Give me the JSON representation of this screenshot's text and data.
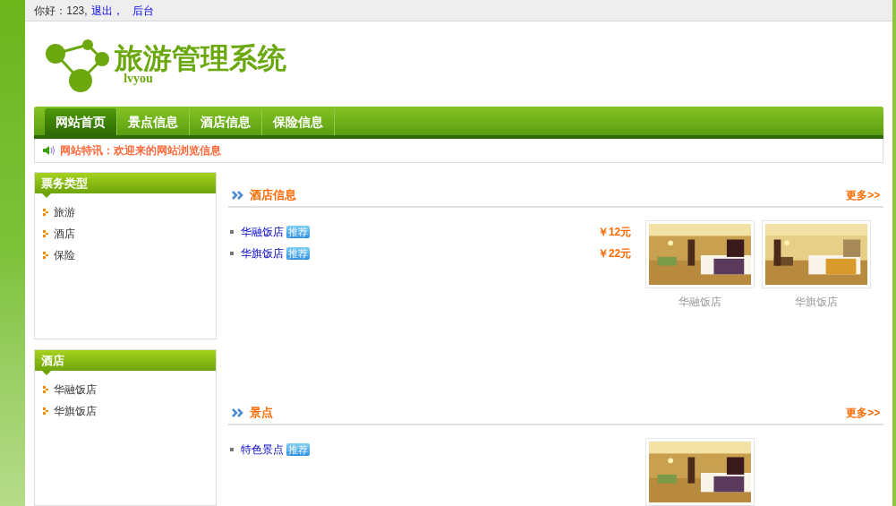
{
  "top_bar": {
    "greeting": "你好：123,",
    "links": [
      "退出，",
      "后台"
    ]
  },
  "logo": {
    "title": "旅游管理系统",
    "subtitle": "lvyou"
  },
  "nav": [
    {
      "label": "网站首页",
      "selected": true
    },
    {
      "label": "景点信息",
      "selected": false
    },
    {
      "label": "酒店信息",
      "selected": false
    },
    {
      "label": "保险信息",
      "selected": false
    }
  ],
  "notice": "网站特讯：欢迎来的网站浏览信息",
  "sidebar": [
    {
      "title": "票务类型",
      "items": [
        "旅游",
        "酒店",
        "保险"
      ]
    },
    {
      "title": "酒店",
      "items": [
        "华融饭店",
        "华旗饭店"
      ]
    }
  ],
  "sections": [
    {
      "title": "酒店信息",
      "more": "更多>>",
      "items": [
        {
          "name": "华融饭店",
          "badge": "推荐",
          "price": "￥12元"
        },
        {
          "name": "华旗饭店",
          "badge": "推荐",
          "price": "￥22元"
        }
      ],
      "photos": [
        {
          "kind": "picture",
          "caption": "华融饭店"
        },
        {
          "kind": "picture",
          "caption": "华旗饭店"
        }
      ]
    },
    {
      "title": "景点",
      "more": "更多>>",
      "items": [
        {
          "name": "特色景点",
          "badge": "推荐"
        }
      ],
      "photos": [
        {
          "kind": "picture"
        }
      ]
    }
  ]
}
